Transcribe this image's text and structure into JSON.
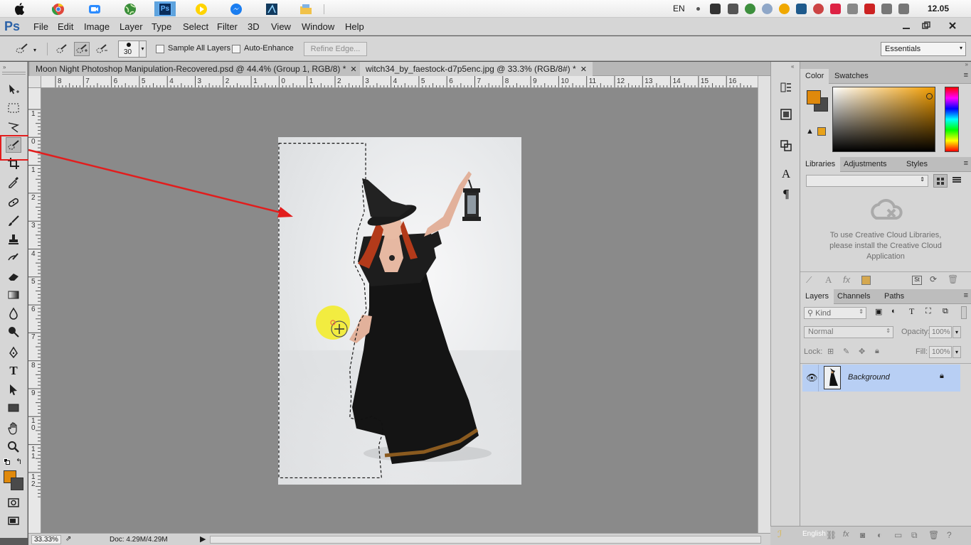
{
  "taskbar": {
    "apps": [
      {
        "name": "apple-icon",
        "color": "#111111"
      },
      {
        "name": "chrome-icon",
        "color": "#e0473b"
      },
      {
        "name": "zoom-icon",
        "color": "#2d8cff"
      },
      {
        "name": "network-globe-icon",
        "color": "#3a8e3a"
      },
      {
        "name": "photoshop-icon",
        "color": "#0a2d5a",
        "label": "Ps"
      },
      {
        "name": "media-player-icon",
        "color": "#ffd400"
      },
      {
        "name": "messenger-icon",
        "color": "#1a7df0"
      },
      {
        "name": "vector-app-icon",
        "color": "#123a5e"
      },
      {
        "name": "folder-icon",
        "color": "#f1c24a"
      }
    ],
    "lang": "EN",
    "clock": "12.05"
  },
  "app": {
    "logo": "Ps",
    "menus": [
      "File",
      "Edit",
      "Image",
      "Layer",
      "Type",
      "Select",
      "Filter",
      "3D",
      "View",
      "Window",
      "Help"
    ]
  },
  "options": {
    "brush_size": "30",
    "sample_all_layers": "Sample All Layers",
    "auto_enhance": "Auto-Enhance",
    "refine_edge": "Refine Edge...",
    "workspace": "Essentials"
  },
  "documents": {
    "tabs": [
      {
        "label": "Moon Night Photoshop Manipulation-Recovered.psd @ 44.4% (Group 1, RGB/8) *",
        "active": false
      },
      {
        "label": "witch34_by_faestock-d7p5enc.jpg @ 33.3% (RGB/8#) *",
        "active": true
      }
    ],
    "ruler_h": [
      "8",
      "7",
      "6",
      "5",
      "4",
      "3",
      "2",
      "1",
      "0",
      "1",
      "2",
      "3",
      "4",
      "5",
      "6",
      "7",
      "8",
      "9",
      "10",
      "11",
      "12",
      "13",
      "14",
      "15",
      "16"
    ],
    "ruler_v": [
      "1",
      "0",
      "1",
      "2",
      "3",
      "4",
      "5",
      "6",
      "7",
      "8",
      "9",
      "1\n0",
      "1\n1",
      "1\n2"
    ]
  },
  "status": {
    "zoom": "33.33%",
    "doc": "Doc: 4.29M/4.29M"
  },
  "color_panel": {
    "tabs": [
      "Color",
      "Swatches"
    ],
    "foreground": "#e0890b",
    "background": "#4a4a4a"
  },
  "libraries_panel": {
    "tabs": [
      "Libraries",
      "Adjustments",
      "Styles"
    ],
    "message": "To use Creative Cloud Libraries, please install the Creative Cloud Application"
  },
  "layers_panel": {
    "tabs": [
      "Layers",
      "Channels",
      "Paths"
    ],
    "kind": "Kind",
    "blend": "Normal",
    "opacity_label": "Opacity:",
    "opacity": "100%",
    "lock_label": "Lock:",
    "fill_label": "Fill:",
    "fill": "100%",
    "layers": [
      {
        "name": "Background",
        "visible": true,
        "locked": true
      }
    ]
  },
  "tray": {
    "language": "English"
  }
}
